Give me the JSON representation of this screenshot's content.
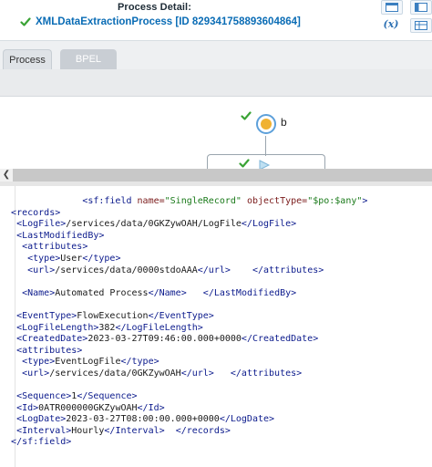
{
  "header": {
    "title": "Process Detail:",
    "process_name": "XMLDataExtractionProcess [ID 829341758893604864]",
    "fx_label": "(x)"
  },
  "tabs": [
    {
      "label": "Process",
      "active": true
    },
    {
      "label": "BPEL",
      "active": false
    }
  ],
  "diagram": {
    "node_label": "b"
  },
  "code_lines": [
    {
      "indent": "               ",
      "parts": [
        [
          "t",
          "<sf:field "
        ],
        [
          "a",
          "name="
        ],
        [
          "v",
          "\"SingleRecord\""
        ],
        [
          "a",
          " objectType="
        ],
        [
          "v",
          "\"$po:$any\""
        ],
        [
          "t",
          ">"
        ]
      ]
    },
    {
      "indent": "  ",
      "parts": [
        [
          "t",
          "<records>"
        ]
      ]
    },
    {
      "indent": "   ",
      "parts": [
        [
          "t",
          "<LogFile>"
        ],
        [
          "x",
          "/services/data/0GKZywOAH/LogFile"
        ],
        [
          "t",
          "</LogFile>"
        ]
      ]
    },
    {
      "indent": "   ",
      "parts": [
        [
          "t",
          "<LastModifiedBy>"
        ]
      ]
    },
    {
      "indent": "    ",
      "parts": [
        [
          "t",
          "<attributes>"
        ]
      ]
    },
    {
      "indent": "     ",
      "parts": [
        [
          "t",
          "<type>"
        ],
        [
          "x",
          "User"
        ],
        [
          "t",
          "</type>"
        ]
      ]
    },
    {
      "indent": "     ",
      "parts": [
        [
          "t",
          "<url>"
        ],
        [
          "x",
          "/services/data/0000stdoAAA"
        ],
        [
          "t",
          "</url>"
        ],
        [
          "x",
          "    "
        ],
        [
          "t",
          "</attributes>"
        ]
      ]
    },
    {
      "indent": "",
      "parts": []
    },
    {
      "indent": "    ",
      "parts": [
        [
          "t",
          "<Name>"
        ],
        [
          "x",
          "Automated Process"
        ],
        [
          "t",
          "</Name>"
        ],
        [
          "x",
          "   "
        ],
        [
          "t",
          "</LastModifiedBy>"
        ]
      ]
    },
    {
      "indent": "",
      "parts": []
    },
    {
      "indent": "   ",
      "parts": [
        [
          "t",
          "<EventType>"
        ],
        [
          "x",
          "FlowExecution"
        ],
        [
          "t",
          "</EventType>"
        ]
      ]
    },
    {
      "indent": "   ",
      "parts": [
        [
          "t",
          "<LogFileLength>"
        ],
        [
          "x",
          "382"
        ],
        [
          "t",
          "</LogFileLength>"
        ]
      ]
    },
    {
      "indent": "   ",
      "parts": [
        [
          "t",
          "<CreatedDate>"
        ],
        [
          "x",
          "2023-03-27T09:46:00.000+0000"
        ],
        [
          "t",
          "</CreatedDate>"
        ]
      ]
    },
    {
      "indent": "   ",
      "parts": [
        [
          "t",
          "<attributes>"
        ]
      ]
    },
    {
      "indent": "    ",
      "parts": [
        [
          "t",
          "<type>"
        ],
        [
          "x",
          "EventLogFile"
        ],
        [
          "t",
          "</type>"
        ]
      ]
    },
    {
      "indent": "    ",
      "parts": [
        [
          "t",
          "<url>"
        ],
        [
          "x",
          "/services/data/0GKZywOAH"
        ],
        [
          "t",
          "</url>"
        ],
        [
          "x",
          "   "
        ],
        [
          "t",
          "</attributes>"
        ]
      ]
    },
    {
      "indent": "",
      "parts": []
    },
    {
      "indent": "   ",
      "parts": [
        [
          "t",
          "<Sequence>"
        ],
        [
          "x",
          "1"
        ],
        [
          "t",
          "</Sequence>"
        ]
      ]
    },
    {
      "indent": "   ",
      "parts": [
        [
          "t",
          "<Id>"
        ],
        [
          "x",
          "0ATR000000GKZywOAH"
        ],
        [
          "t",
          "</Id>"
        ]
      ]
    },
    {
      "indent": "   ",
      "parts": [
        [
          "t",
          "<LogDate>"
        ],
        [
          "x",
          "2023-03-27T08:00:00.000+0000"
        ],
        [
          "t",
          "</LogDate>"
        ]
      ]
    },
    {
      "indent": "   ",
      "parts": [
        [
          "t",
          "<Interval>"
        ],
        [
          "x",
          "Hourly"
        ],
        [
          "t",
          "</Interval>"
        ],
        [
          "x",
          "  "
        ],
        [
          "t",
          "</records>"
        ]
      ]
    },
    {
      "indent": "  ",
      "parts": [
        [
          "t",
          "</sf:field>"
        ]
      ]
    }
  ],
  "colors": {
    "link": "#0a6cb5",
    "check": "#3aa335",
    "tag": "#0b1a8c",
    "attr": "#7a1a1a",
    "value": "#1a7a1a"
  }
}
